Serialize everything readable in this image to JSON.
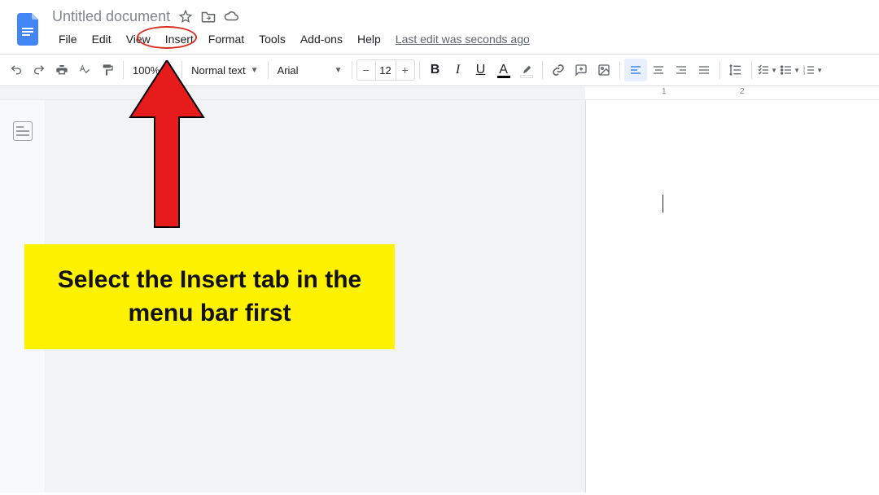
{
  "header": {
    "title": "Untitled document",
    "last_edit": "Last edit was seconds ago"
  },
  "menu": {
    "file": "File",
    "edit": "Edit",
    "view": "View",
    "insert": "Insert",
    "format": "Format",
    "tools": "Tools",
    "addons": "Add-ons",
    "help": "Help"
  },
  "toolbar": {
    "zoom": "100%",
    "style": "Normal text",
    "font": "Arial",
    "font_size": "12",
    "bold": "B",
    "italic": "I",
    "underline": "U",
    "text_a": "A"
  },
  "ruler": {
    "n1": "1",
    "n2": "2"
  },
  "annotation": {
    "callout_text": "Select the Insert tab in the menu bar first"
  }
}
